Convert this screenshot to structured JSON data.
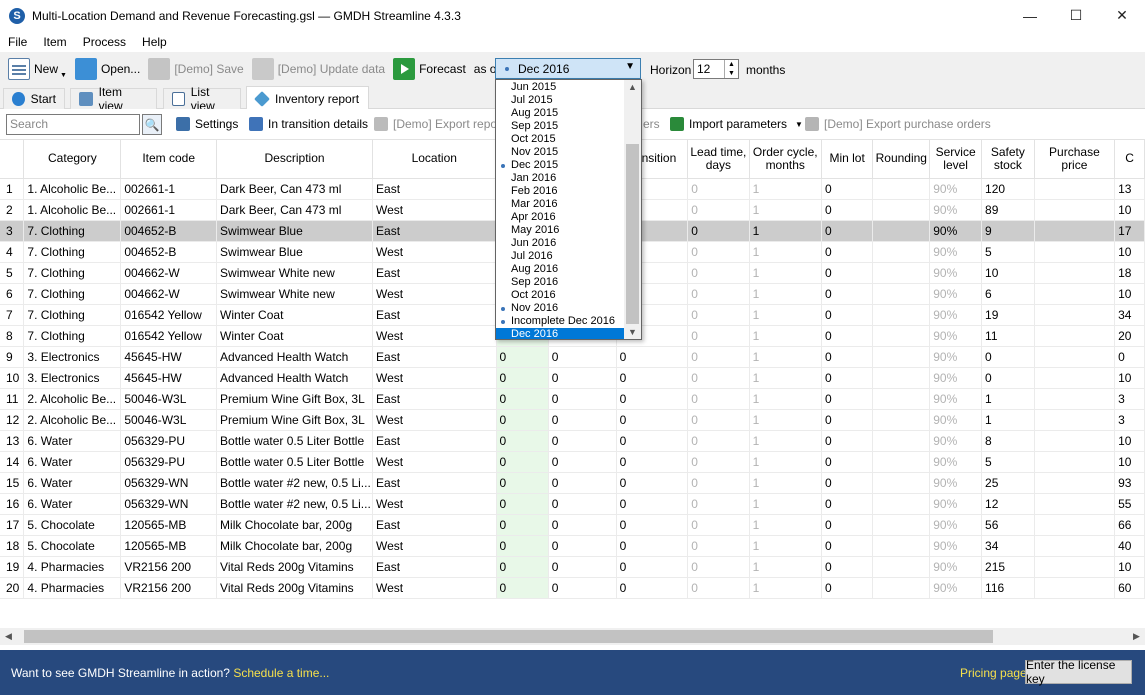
{
  "window": {
    "title": "Multi-Location Demand and Revenue Forecasting.gsl — GMDH Streamline 4.3.3",
    "app_icon_letter": "S",
    "controls": {
      "minimize": "—",
      "maximize": "☐",
      "close": "✕"
    }
  },
  "menu": [
    "File",
    "Item",
    "Process",
    "Help"
  ],
  "toolbar": {
    "new": "New",
    "open": "Open...",
    "save": "[Demo] Save",
    "update": "[Demo] Update data",
    "forecast": "Forecast",
    "as_of": "as of",
    "date_value": "Dec 2016",
    "horizon_label": "Horizon",
    "horizon_value": "12",
    "months_label": "months"
  },
  "tabs": [
    "Start",
    "Item view",
    "List view",
    "Inventory report"
  ],
  "active_tab": "Inventory report",
  "searchbar": {
    "placeholder": "Search",
    "settings": "Settings",
    "in_transition": "In transition details",
    "export_report": "[Demo] Export report",
    "export_orders_partial": "ers",
    "import_parameters": "Import parameters",
    "export_purchase_orders": "[Demo] Export purchase orders"
  },
  "columns": [
    "",
    "Category",
    "Item code",
    "Description",
    "Location",
    "",
    "",
    "transition",
    "Lead time, days",
    "Order cycle, months",
    "Min lot",
    "Rounding",
    "Service level",
    "Safety stock",
    "Purchase price",
    "C"
  ],
  "rows": [
    [
      "1",
      "1. Alcoholic Be...",
      "002661-1",
      "Dark Beer, Can 473 ml",
      "East",
      "",
      "",
      "",
      "0",
      "1",
      "0",
      "",
      "90%",
      "120",
      "",
      "13"
    ],
    [
      "2",
      "1. Alcoholic Be...",
      "002661-1",
      "Dark Beer, Can 473 ml",
      "West",
      "",
      "",
      "",
      "0",
      "1",
      "0",
      "",
      "90%",
      "89",
      "",
      "10"
    ],
    [
      "3",
      "7. Clothing",
      "004652-B",
      "Swimwear Blue",
      "East",
      "",
      "",
      "",
      "0",
      "1",
      "0",
      "",
      "90%",
      "9",
      "",
      "17"
    ],
    [
      "4",
      "7. Clothing",
      "004652-B",
      "Swimwear Blue",
      "West",
      "",
      "",
      "",
      "0",
      "1",
      "0",
      "",
      "90%",
      "5",
      "",
      "10"
    ],
    [
      "5",
      "7. Clothing",
      "004662-W",
      "Swimwear White new",
      "East",
      "",
      "",
      "",
      "0",
      "1",
      "0",
      "",
      "90%",
      "10",
      "",
      "18"
    ],
    [
      "6",
      "7. Clothing",
      "004662-W",
      "Swimwear White new",
      "West",
      "",
      "",
      "",
      "0",
      "1",
      "0",
      "",
      "90%",
      "6",
      "",
      "10"
    ],
    [
      "7",
      "7. Clothing",
      "016542 Yellow",
      "Winter Coat",
      "East",
      "",
      "",
      "",
      "0",
      "1",
      "0",
      "",
      "90%",
      "19",
      "",
      "34"
    ],
    [
      "8",
      "7. Clothing",
      "016542 Yellow",
      "Winter Coat",
      "West",
      "",
      "",
      "",
      "0",
      "1",
      "0",
      "",
      "90%",
      "11",
      "",
      "20"
    ],
    [
      "9",
      "3. Electronics",
      "45645-HW",
      "Advanced Health Watch",
      "East",
      "0",
      "0",
      "0",
      "0",
      "1",
      "0",
      "",
      "90%",
      "0",
      "",
      "0"
    ],
    [
      "10",
      "3. Electronics",
      "45645-HW",
      "Advanced Health Watch",
      "West",
      "0",
      "0",
      "0",
      "0",
      "1",
      "0",
      "",
      "90%",
      "0",
      "",
      "10"
    ],
    [
      "11",
      "2. Alcoholic Be...",
      "50046-W3L",
      "Premium Wine Gift Box, 3L",
      "East",
      "0",
      "0",
      "0",
      "0",
      "1",
      "0",
      "",
      "90%",
      "1",
      "",
      "3"
    ],
    [
      "12",
      "2. Alcoholic Be...",
      "50046-W3L",
      "Premium Wine Gift Box, 3L",
      "West",
      "0",
      "0",
      "0",
      "0",
      "1",
      "0",
      "",
      "90%",
      "1",
      "",
      "3"
    ],
    [
      "13",
      "6. Water",
      "056329-PU",
      "Bottle water 0.5 Liter Bottle",
      "East",
      "0",
      "0",
      "0",
      "0",
      "1",
      "0",
      "",
      "90%",
      "8",
      "",
      "10"
    ],
    [
      "14",
      "6. Water",
      "056329-PU",
      "Bottle water 0.5 Liter Bottle",
      "West",
      "0",
      "0",
      "0",
      "0",
      "1",
      "0",
      "",
      "90%",
      "5",
      "",
      "10"
    ],
    [
      "15",
      "6. Water",
      "056329-WN",
      "Bottle water #2 new, 0.5 Li...",
      "East",
      "0",
      "0",
      "0",
      "0",
      "1",
      "0",
      "",
      "90%",
      "25",
      "",
      "93"
    ],
    [
      "16",
      "6. Water",
      "056329-WN",
      "Bottle water #2 new, 0.5 Li...",
      "West",
      "0",
      "0",
      "0",
      "0",
      "1",
      "0",
      "",
      "90%",
      "12",
      "",
      "55"
    ],
    [
      "17",
      "5. Chocolate",
      "120565-MB",
      "Milk Chocolate bar, 200g",
      "East",
      "0",
      "0",
      "0",
      "0",
      "1",
      "0",
      "",
      "90%",
      "56",
      "",
      "66"
    ],
    [
      "18",
      "5. Chocolate",
      "120565-MB",
      "Milk Chocolate bar, 200g",
      "West",
      "0",
      "0",
      "0",
      "0",
      "1",
      "0",
      "",
      "90%",
      "34",
      "",
      "40"
    ],
    [
      "19",
      "4. Pharmacies",
      "VR2156 200",
      "Vital Reds 200g Vitamins",
      "East",
      "0",
      "0",
      "0",
      "0",
      "1",
      "0",
      "",
      "90%",
      "215",
      "",
      "10"
    ],
    [
      "20",
      "4. Pharmacies",
      "VR2156 200",
      "Vital Reds 200g Vitamins",
      "West",
      "0",
      "0",
      "0",
      "0",
      "1",
      "0",
      "",
      "90%",
      "116",
      "",
      "60"
    ]
  ],
  "selected_row": 3,
  "dropdown": {
    "items": [
      {
        "label": "Jun 2015",
        "marked": false
      },
      {
        "label": "Jul 2015",
        "marked": false
      },
      {
        "label": "Aug 2015",
        "marked": false
      },
      {
        "label": "Sep 2015",
        "marked": false
      },
      {
        "label": "Oct 2015",
        "marked": false
      },
      {
        "label": "Nov 2015",
        "marked": false
      },
      {
        "label": "Dec 2015",
        "marked": true
      },
      {
        "label": "Jan 2016",
        "marked": false
      },
      {
        "label": "Feb 2016",
        "marked": false
      },
      {
        "label": "Mar 2016",
        "marked": false
      },
      {
        "label": "Apr 2016",
        "marked": false
      },
      {
        "label": "May 2016",
        "marked": false
      },
      {
        "label": "Jun 2016",
        "marked": false
      },
      {
        "label": "Jul 2016",
        "marked": false
      },
      {
        "label": "Aug 2016",
        "marked": false
      },
      {
        "label": "Sep 2016",
        "marked": false
      },
      {
        "label": "Oct 2016",
        "marked": false
      },
      {
        "label": "Nov 2016",
        "marked": true
      },
      {
        "label": "Incomplete Dec 2016",
        "marked": true
      },
      {
        "label": "Dec 2016",
        "marked": false
      }
    ],
    "selected": "Dec 2016"
  },
  "footer": {
    "prompt": "Want to see GMDH Streamline in action?",
    "schedule": "Schedule a time...",
    "pricing": "Pricing page",
    "license": "Enter the license key"
  },
  "icons": {
    "new": "new-document-icon",
    "open": "folder-icon",
    "save": "disk-icon",
    "update": "refresh-icon",
    "forecast": "play-icon",
    "search": "magnifier-icon",
    "settings": "gear-icon",
    "transition": "truck-icon",
    "export": "export-icon",
    "import": "excel-import-icon",
    "cart": "cart-icon"
  },
  "colors": {
    "selected_row": "#cccccc",
    "dropdown_highlight": "#0078d7",
    "footer_bg": "#27497e",
    "footer_link": "#f5e04c",
    "green_column": "#e8f8e8"
  }
}
